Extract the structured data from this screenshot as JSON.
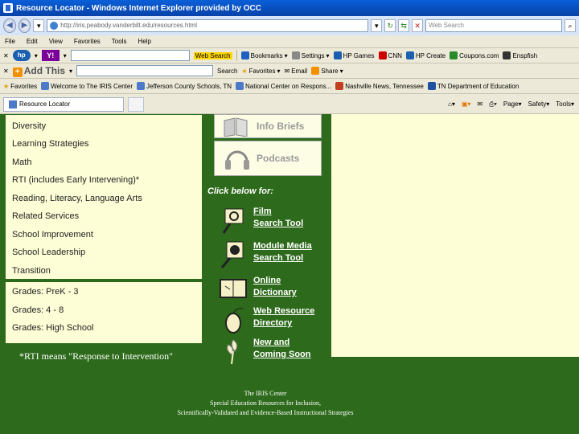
{
  "window": {
    "title": "Resource Locator - Windows Internet Explorer provided by OCC"
  },
  "address": {
    "url": "http://iris.peabody.vanderbilt.edu/resources.html"
  },
  "search": {
    "placeholder": "Web Search"
  },
  "menu": [
    "File",
    "Edit",
    "View",
    "Favorites",
    "Tools",
    "Help"
  ],
  "toolbar1": {
    "search_label": "Web Search",
    "items": [
      "Bookmarks",
      "Settings",
      "HP Games",
      "CNN",
      "HP Create",
      "Coupons.com",
      "Enspfish"
    ]
  },
  "toolbar2": {
    "addthis": "Add This",
    "search": "Search",
    "favorites": "Favorites",
    "email": "Email",
    "share": "Share"
  },
  "favbar": {
    "favorites": "Favorites",
    "links": [
      "Welcome to The IRIS Center",
      "Jefferson County Schools, TN",
      "National Center on Respons...",
      "Nashville News, Tennessee",
      "TN Department of Education"
    ]
  },
  "tabbar": {
    "tab_title": "Resource Locator",
    "page_menu": "Page",
    "safety_menu": "Safety",
    "tools_menu": "Tools"
  },
  "left_panel": {
    "topics": [
      "Diversity",
      "Learning Strategies",
      "Math",
      "RTI (includes Early Intervening)*",
      "Reading, Literacy, Language Arts",
      "Related Services",
      "School Improvement",
      "School Leadership",
      "Transition"
    ],
    "grades": [
      "Grades: PreK - 3",
      "Grades: 4 - 8",
      "Grades: High School"
    ],
    "footnote": "*RTI means \"Response to Intervention\""
  },
  "middle": {
    "info_briefs": "Info Briefs",
    "podcasts": "Podcasts",
    "click_below": "Click below for:",
    "tools": [
      {
        "line1": "Film",
        "line2": "Search Tool",
        "icon": "film-reel-icon"
      },
      {
        "line1": "Module Media",
        "line2": "Search Tool",
        "icon": "media-icon"
      },
      {
        "line1": "Online",
        "line2": "Dictionary",
        "icon": "dictionary-icon"
      },
      {
        "line1": "Web Resource",
        "line2": "Directory",
        "icon": "mouse-icon"
      },
      {
        "line1": "New and",
        "line2": "Coming Soon",
        "icon": "flower-icon"
      }
    ]
  },
  "footer": {
    "line1": "The IRIS Center",
    "line2": "Special Education Resources for Inclusion,",
    "line3": "Scientifically-Validated and Evidence-Based Instructional Strategies"
  },
  "colors": {
    "page_bg": "#2e6a1c",
    "panel_bg": "#fdfdd6",
    "titlebar": "#0a5fd8"
  }
}
